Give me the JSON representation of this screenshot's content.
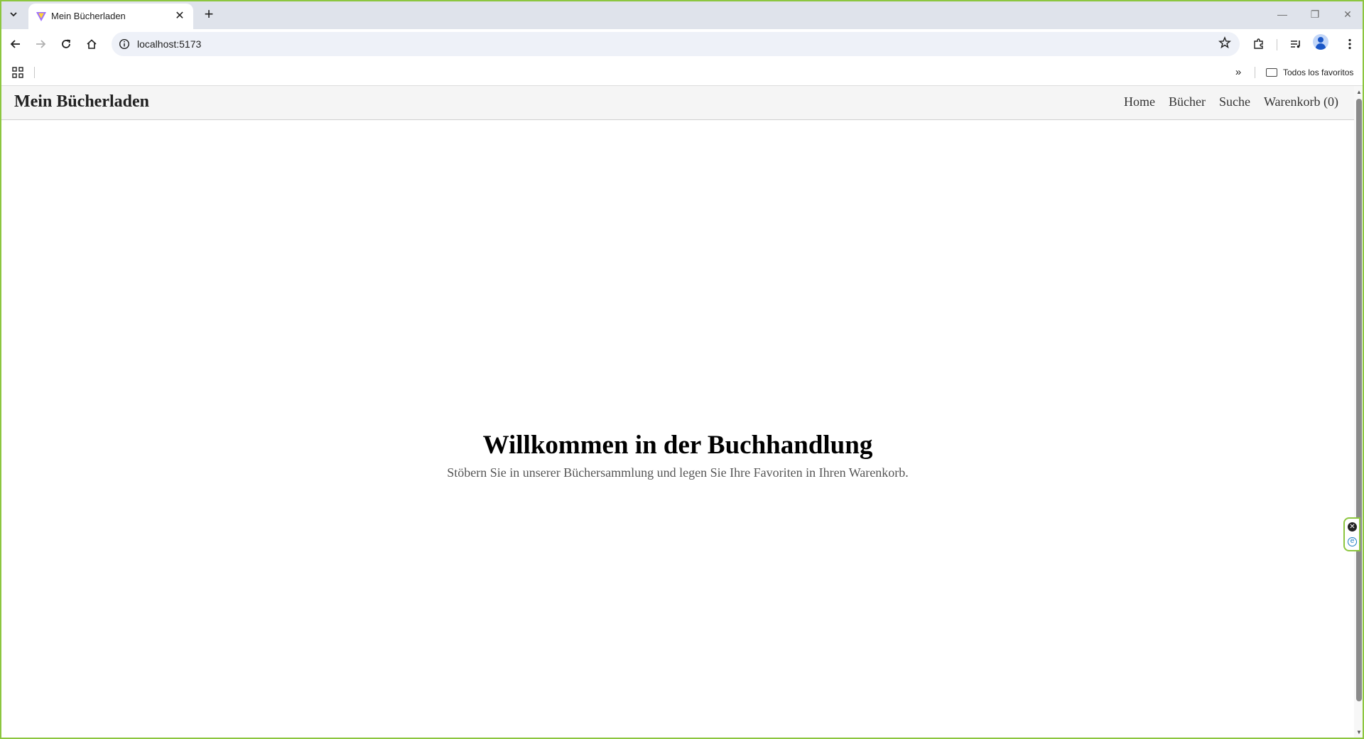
{
  "browser": {
    "tab": {
      "title": "Mein Bücherladen",
      "close_glyph": "✕",
      "favicon_icon": "vite-icon"
    },
    "new_tab_glyph": "+",
    "address": {
      "url": "localhost:5173"
    },
    "window_controls": {
      "minimize": "—",
      "restore": "❐",
      "close": "✕"
    },
    "bookmarks": {
      "all_bookmarks_label": "Todos los favoritos",
      "more_glyph": "»"
    }
  },
  "site": {
    "logo": "Mein Bücherladen",
    "nav": [
      {
        "label": "Home"
      },
      {
        "label": "Bücher"
      },
      {
        "label": "Suche"
      },
      {
        "label": "Warenkorb (0)"
      }
    ]
  },
  "hero": {
    "title": "Willkommen in der Buchhandlung",
    "subtitle": "Stöbern Sie in unserer Büchersammlung und legen Sie Ihre Favoriten in Ihren Warenkorb."
  },
  "colors": {
    "window_border": "#8cc63f",
    "header_bg": "#f5f5f5",
    "tabstrip_bg": "#dfe3eb"
  }
}
